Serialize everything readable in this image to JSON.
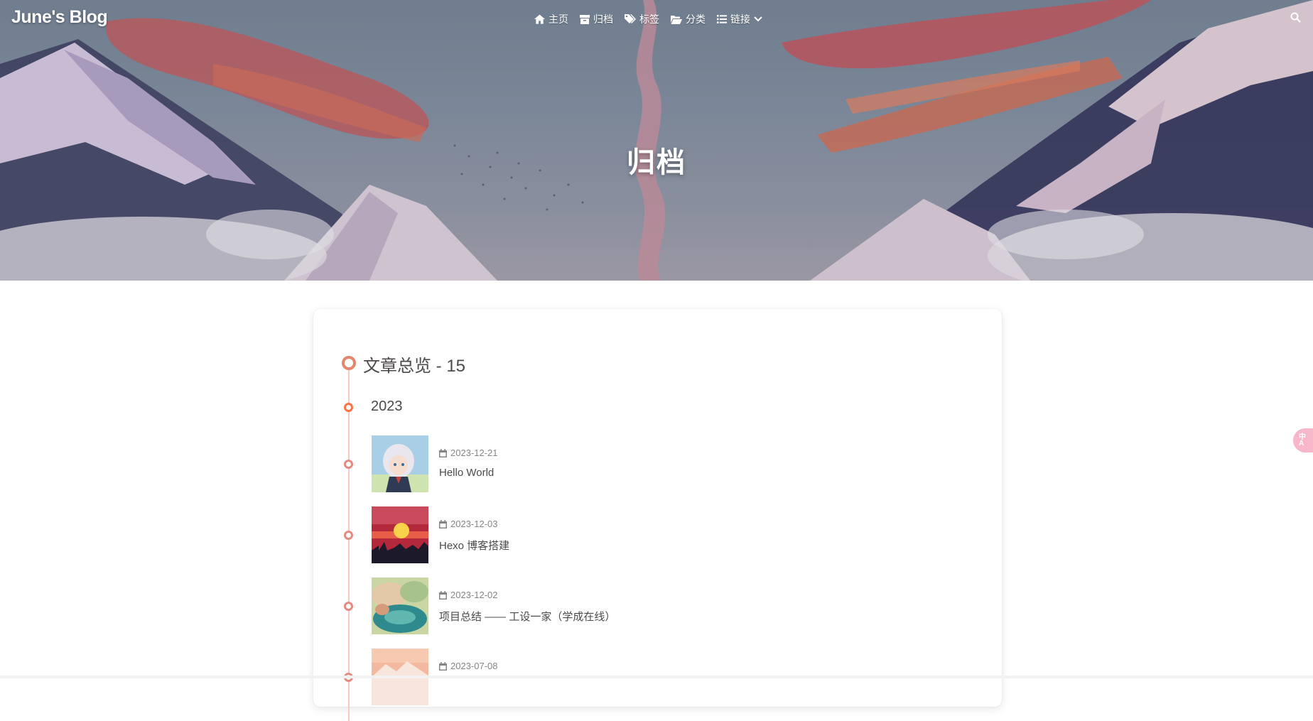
{
  "site": {
    "title": "June's Blog"
  },
  "nav": {
    "items": [
      {
        "label": "主页",
        "icon": "home-icon"
      },
      {
        "label": "归档",
        "icon": "archive-icon"
      },
      {
        "label": "标签",
        "icon": "tags-icon"
      },
      {
        "label": "分类",
        "icon": "folder-open-icon"
      },
      {
        "label": "链接",
        "icon": "list-icon",
        "has_dropdown": true
      }
    ],
    "search_icon": "search-icon"
  },
  "page": {
    "title": "归档"
  },
  "archive": {
    "overview": "文章总览 - 15",
    "year": "2023",
    "posts": [
      {
        "date": "2023-12-21",
        "title": "Hello World"
      },
      {
        "date": "2023-12-03",
        "title": "Hexo 博客搭建"
      },
      {
        "date": "2023-12-02",
        "title": "项目总结 —— 工设一家（学成在线）"
      },
      {
        "date": "2023-07-08",
        "title": ""
      }
    ]
  },
  "colors": {
    "accent": "#e3866b",
    "timeline": "#f6c9c4",
    "text": "#4c4948",
    "meta": "#858585"
  }
}
